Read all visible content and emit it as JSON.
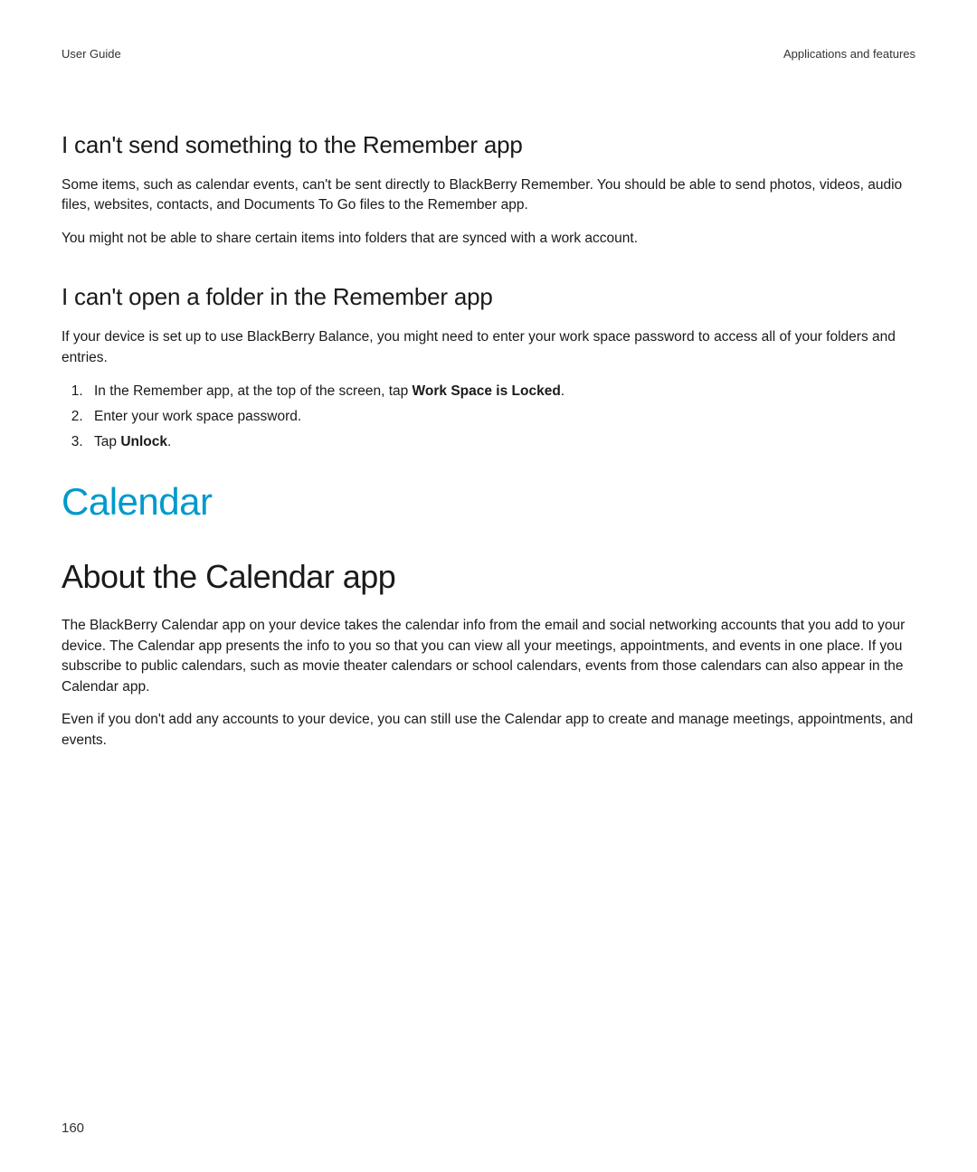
{
  "header": {
    "left": "User Guide",
    "right": "Applications and features"
  },
  "section1": {
    "heading": "I can't send something to the Remember app",
    "p1": "Some items, such as calendar events, can't be sent directly to BlackBerry Remember. You should be able to send photos, videos, audio files, websites, contacts, and Documents To Go files to the Remember app.",
    "p2": "You might not be able to share certain items into folders that are synced with a work account."
  },
  "section2": {
    "heading": "I can't open a folder in the Remember app",
    "p1": "If your device is set up to use BlackBerry Balance, you might need to enter your work space password to access all of your folders and entries.",
    "steps": {
      "s1_pre": "In the Remember app, at the top of the screen, tap ",
      "s1_bold": "Work Space is Locked",
      "s1_post": ".",
      "s2": "Enter your work space password.",
      "s3_pre": "Tap ",
      "s3_bold": "Unlock",
      "s3_post": "."
    }
  },
  "chapter": {
    "title": "Calendar"
  },
  "section3": {
    "heading": "About the Calendar app",
    "p1": "The BlackBerry Calendar app on your device takes the calendar info from the email and social networking accounts that you add to your device. The Calendar app presents the info to you so that you can view all your meetings, appointments, and events in one place. If you subscribe to public calendars, such as movie theater calendars or school calendars, events from those calendars can also appear in the Calendar app.",
    "p2": "Even if you don't add any accounts to your device, you can still use the Calendar app to create and manage meetings, appointments, and events."
  },
  "footer": {
    "page_number": "160"
  }
}
